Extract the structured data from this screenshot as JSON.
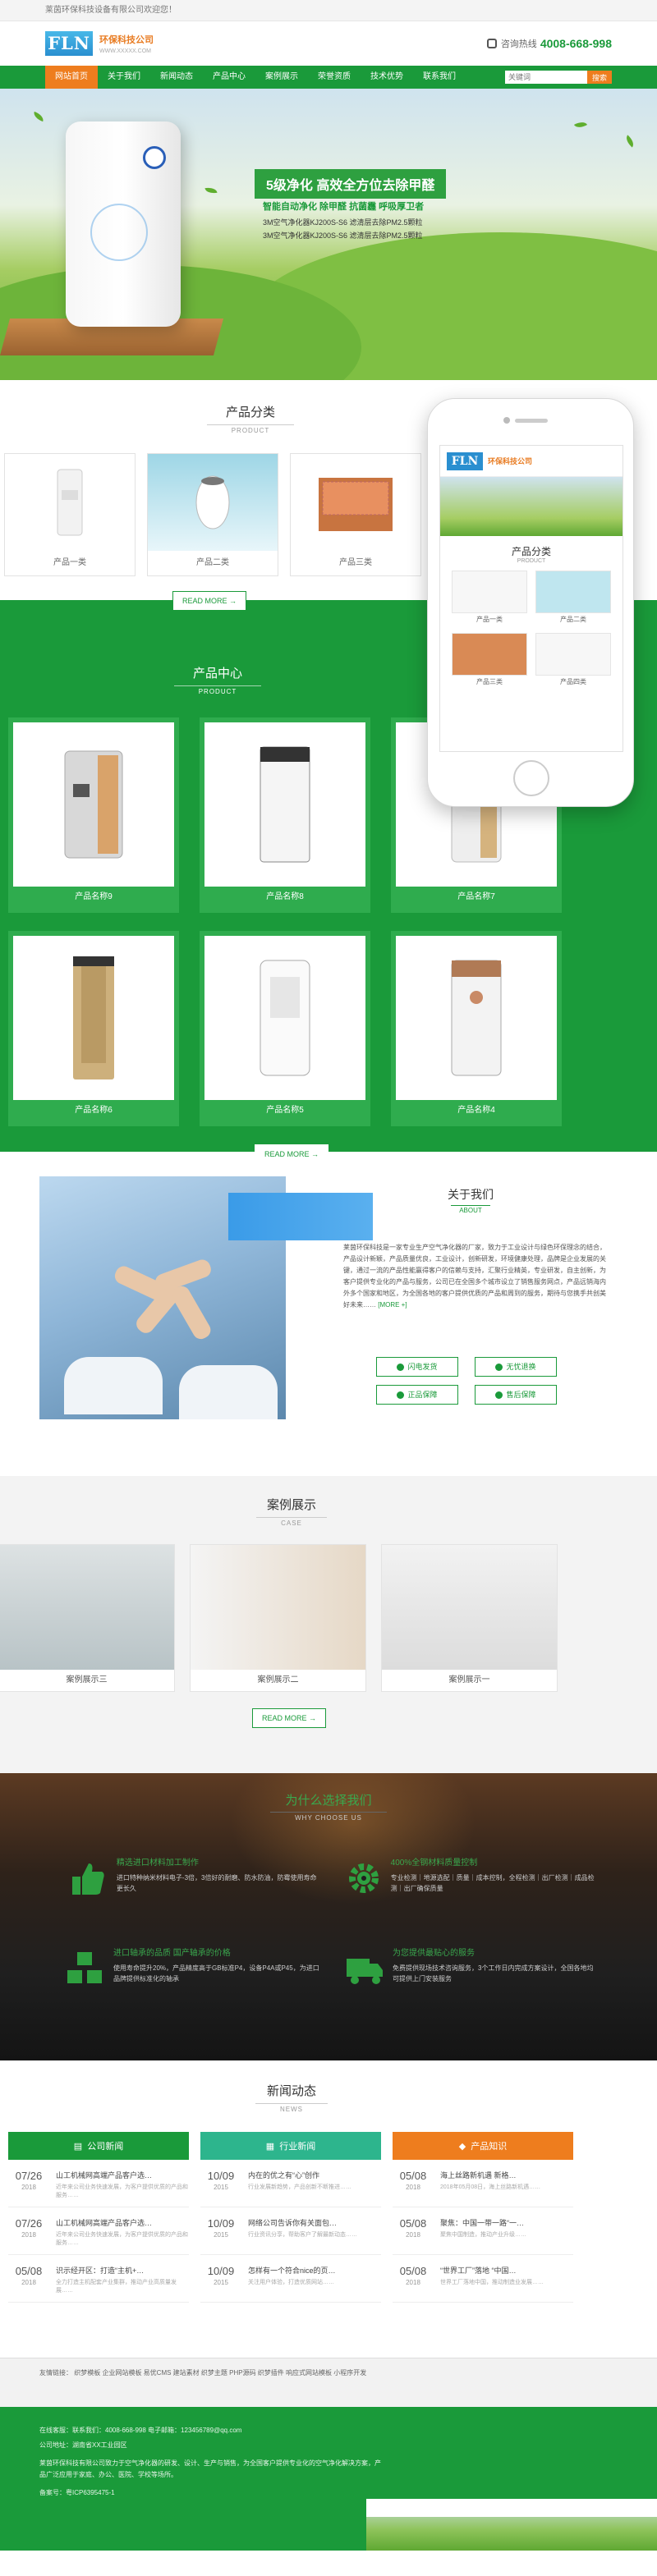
{
  "topbar": {
    "text": "莱茵环保科技设备有限公司欢迎您！"
  },
  "header": {
    "logo_letters": "FLN",
    "logo_name": "环保科技公司",
    "logo_sub": "WWW.XXXXX.COM",
    "phone_label": "咨询热线",
    "phone_number": "4008-668-998"
  },
  "nav": {
    "items": [
      "网站首页",
      "关于我们",
      "新闻动态",
      "产品中心",
      "案例展示",
      "荣誉资质",
      "技术优势",
      "联系我们"
    ],
    "search_placeholder": "关键词",
    "search_button": "搜索"
  },
  "banner": {
    "title": "5级净化 高效全方位去除甲醛",
    "subtitle": "智能自动净化 除甲醛 抗菌霾 呼吸厚卫者",
    "line1": "3M空气净化器KJ200S-S6 滤清层去除PM2.5颗粒",
    "line2": "3M空气净化器KJ200S-S6 滤清层去除PM2.5颗粒"
  },
  "categories": {
    "title": "产品分类",
    "en": "PRODUCT",
    "items": [
      "产品一类",
      "产品二类",
      "产品三类"
    ],
    "more": "READ MORE →"
  },
  "phone_mock": {
    "logo": "FLN",
    "name": "环保科技公司",
    "section_title": "产品分类",
    "section_en": "PRODUCT",
    "items": [
      "产品一类",
      "产品二类",
      "产品三类",
      "产品四类"
    ]
  },
  "products": {
    "title": "产品中心",
    "en": "PRODUCT",
    "items": [
      "产品名称9",
      "产品名称8",
      "产品名称7",
      "产品名称6",
      "产品名称5",
      "产品名称4"
    ],
    "more": "READ MORE →"
  },
  "about": {
    "title": "关于我们",
    "en": "ABOUT",
    "text": "莱茵环保科技是一家专业生产空气净化器的厂家，致力于工业设计与绿色环保理念的结合，产品设计新颖，产品质量优良，工业设计，创新研发，环境健康处理，品牌是企业发展的关键，通过一流的产品性能赢得客户的信赖与支持，汇聚行业精英，专业研发，自主创新，为客户提供专业化的产品与服务，公司已在全国多个城市设立了销售服务网点，产品远销海内外多个国家和地区，为全国各地的客户提供优质的产品和周到的服务，期待与您携手共创美好未来……",
    "more": "[MORE +]",
    "features": [
      "闪电发货",
      "无忧退换",
      "正品保障",
      "售后保障"
    ]
  },
  "cases": {
    "title": "案例展示",
    "en": "CASE",
    "items": [
      "案例展示三",
      "案例展示二",
      "案例展示一"
    ],
    "more": "READ MORE →"
  },
  "why": {
    "title": "为什么选择我们",
    "en": "WHY CHOOSE US",
    "items": [
      {
        "title": "精选进口材料加工制作",
        "desc": "进口特种纳米材料电子-3倍，3倍好的耐磨、防水防油，防霉使用寿命更长久"
      },
      {
        "title": "400%全钢材料质量控制",
        "desc": "专业检测｜地源选配｜质量｜成本控制，全程检测｜出厂检测｜成品检测｜出厂确保质量"
      },
      {
        "title": "进口轴承的品质 国产轴承的价格",
        "desc": "使用寿命提升20%，产品精度高于GB标准P4，设备P4A或P45，为进口品牌提供标准化的轴承"
      },
      {
        "title": "为您提供最贴心的服务",
        "desc": "免费提供现场技术咨询服务，3个工作日内完成方案设计，全国各地均可提供上门安装服务"
      }
    ]
  },
  "news": {
    "title": "新闻动态",
    "en": "NEWS",
    "columns": [
      {
        "name": "公司新闻",
        "color": "#1a9a3a",
        "items": [
          {
            "md": "07/26",
            "yr": "2018",
            "title": "山工机械网高端产品客户选…",
            "desc": "近年来公司业务快速发展，为客户提供优质的产品和服务……"
          },
          {
            "md": "07/26",
            "yr": "2018",
            "title": "山工机械网高端产品客户选…",
            "desc": "近年来公司业务快速发展，为客户提供优质的产品和服务……"
          },
          {
            "md": "05/08",
            "yr": "2018",
            "title": "识示经开区：打造“主机+…",
            "desc": "全力打造主机配套产业集群，推动产业高质量发展……"
          }
        ]
      },
      {
        "name": "行业新闻",
        "color": "#2db58d",
        "items": [
          {
            "md": "10/09",
            "yr": "2015",
            "title": "内在的优之有“心”创作",
            "desc": "行业发展新趋势，产品创新不断推进……"
          },
          {
            "md": "10/09",
            "yr": "2015",
            "title": "网络公司告诉你有关面包…",
            "desc": "行业资讯分享，帮助客户了解最新动态……"
          },
          {
            "md": "10/09",
            "yr": "2015",
            "title": "怎样有一个符合nice的页…",
            "desc": "关注用户体验，打造优质网站……"
          }
        ]
      },
      {
        "name": "产品知识",
        "color": "#ee7d1e",
        "items": [
          {
            "md": "05/08",
            "yr": "2018",
            "title": "海上丝路新机遇 新格…",
            "desc": "2018年05月08日，海上丝路新机遇……"
          },
          {
            "md": "05/08",
            "yr": "2018",
            "title": "聚焦：中国一带一路“一…",
            "desc": "聚焦中国制造，推动产业升级……"
          },
          {
            "md": "05/08",
            "yr": "2018",
            "title": "“世界工厂”落地 “中国…",
            "desc": "世界工厂落地中国，推动制造业发展……"
          }
        ]
      }
    ]
  },
  "links": {
    "label": "友情链接：",
    "items": "织梦模板 企业网站模板 易优CMS 建站素材 织梦主题 PHP源码 织梦插件 响应式网站模板 小程序开发"
  },
  "footer": {
    "line1": "在线客服：联系我们：4008-668-998 电子邮箱：123456789@qq.com",
    "line2": "公司地址：湖南省XX工业园区",
    "line3": "莱茵环保科技有限公司致力于空气净化器的研发、设计、生产与销售，为全国客户提供专业化的空气净化解决方案，产品广泛应用于家庭、办公、医院、学校等场所。",
    "copyright": "备案号：粤ICP6395475-1"
  },
  "colors": {
    "primary": "#1a9a3a",
    "accent": "#ee7d1e",
    "teal": "#2db58d"
  }
}
